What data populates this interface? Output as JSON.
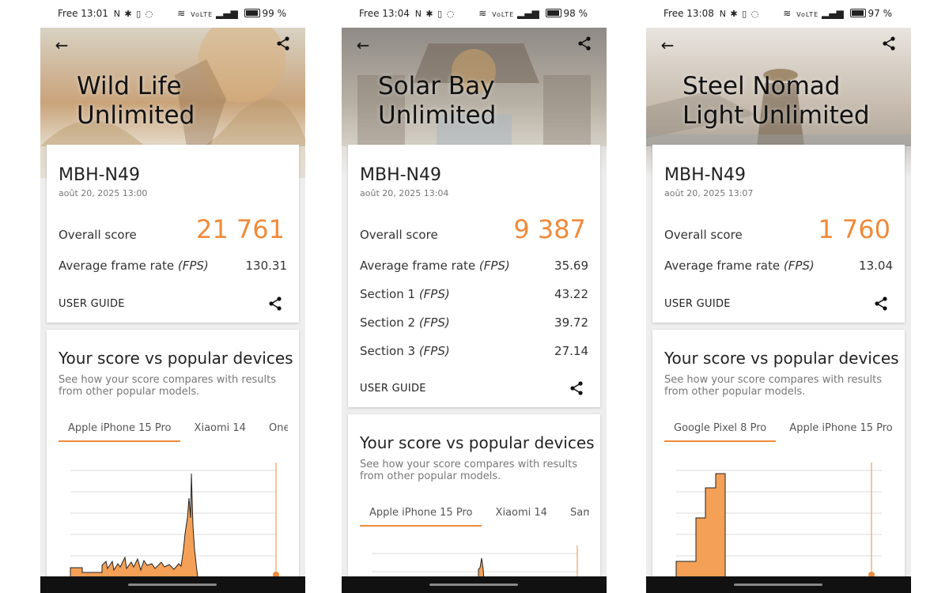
{
  "colors": {
    "accent": "#f08a3a",
    "card": "#ffffff",
    "background": "#eeeeee"
  },
  "phones": [
    {
      "status": {
        "carrier_time": "Free 13:01",
        "icons_left": "N ✱ ▯ ◌",
        "icons_right": "VoLTE",
        "battery": "99 %",
        "battery_level": 0.99
      },
      "title_line1": "Wild Life",
      "title_line2": "Unlimited",
      "device": "MBH-N49",
      "date": "août 20, 2025 13:00",
      "overall_label": "Overall score",
      "overall_score": "21 761",
      "fps_label": "Average frame rate",
      "fps_unit": "(FPS)",
      "fps_value": "130.31",
      "user_guide": "USER GUIDE",
      "compare_title": "Your score vs popular devices",
      "compare_sub": "See how your score compares with results from other popular models.",
      "tabs": [
        "Apple iPhone 15 Pro",
        "Xiaomi 14",
        "OnePlu"
      ]
    },
    {
      "status": {
        "carrier_time": "Free 13:04",
        "icons_left": "N ✱ ▯ ◌",
        "icons_right": "VoLTE",
        "battery": "98 %",
        "battery_level": 0.98
      },
      "title_line1": "Solar Bay",
      "title_line2": "Unlimited",
      "device": "MBH-N49",
      "date": "août 20, 2025 13:04",
      "overall_label": "Overall score",
      "overall_score": "9 387",
      "fps_label": "Average frame rate",
      "fps_unit": "(FPS)",
      "fps_value": "35.69",
      "sections": [
        {
          "label": "Section 1",
          "unit": "(FPS)",
          "value": "43.22"
        },
        {
          "label": "Section 2",
          "unit": "(FPS)",
          "value": "39.72"
        },
        {
          "label": "Section 3",
          "unit": "(FPS)",
          "value": "27.14"
        }
      ],
      "user_guide": "USER GUIDE",
      "compare_title": "Your score vs popular devices",
      "compare_sub": "See how your score compares with results from other popular models.",
      "tabs": [
        "Apple iPhone 15 Pro",
        "Xiaomi 14",
        "Samsur"
      ]
    },
    {
      "status": {
        "carrier_time": "Free 13:08",
        "icons_left": "N ✱ ▯ ◌",
        "icons_right": "VoLTE",
        "battery": "97 %",
        "battery_level": 0.97
      },
      "title_line1": "Steel Nomad",
      "title_line2": "Light Unlimited",
      "device": "MBH-N49",
      "date": "août 20, 2025 13:07",
      "overall_label": "Overall score",
      "overall_score": "1 760",
      "fps_label": "Average frame rate",
      "fps_unit": "(FPS)",
      "fps_value": "13.04",
      "user_guide": "USER GUIDE",
      "compare_title": "Your score vs popular devices",
      "compare_sub": "See how your score compares with results from other popular models.",
      "tabs": [
        "Google Pixel 8 Pro",
        "Apple iPhone 15 Pro"
      ]
    }
  ]
}
